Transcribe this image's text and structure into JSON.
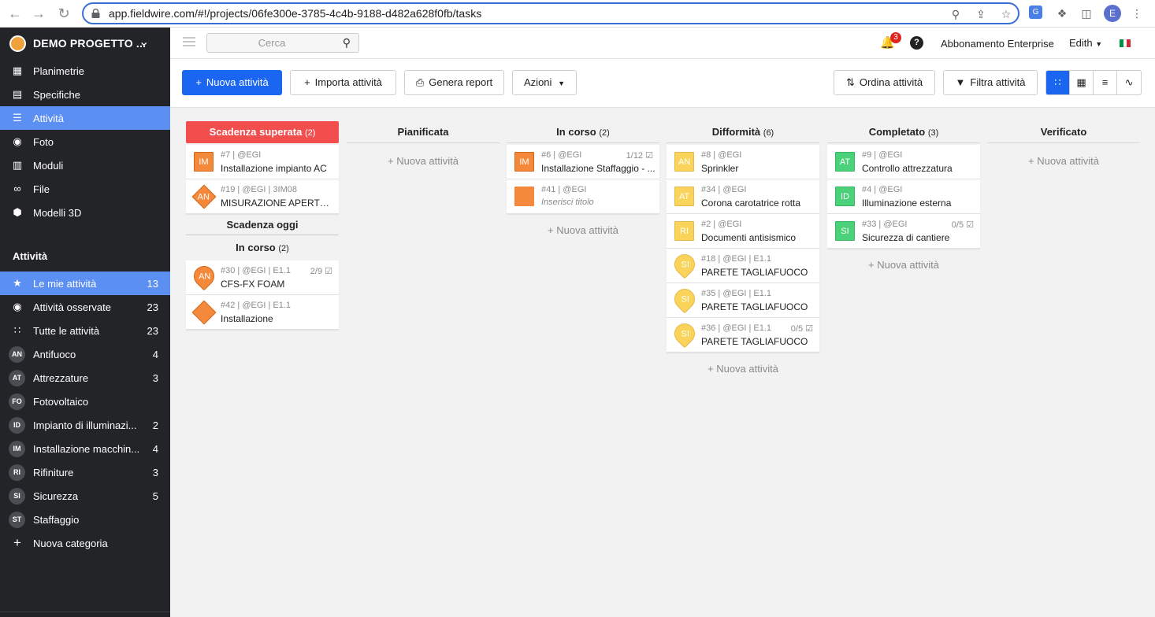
{
  "browser": {
    "url": "app.fieldwire.com/#!/projects/06fe300e-3785-4c4b-9188-d482a628f0fb/tasks",
    "profile_initial": "E"
  },
  "sidebar": {
    "project_name": "DEMO PROGETTO ...",
    "nav_items": [
      {
        "label": "Planimetrie",
        "icon": "floorplan-icon"
      },
      {
        "label": "Specifiche",
        "icon": "specs-icon"
      },
      {
        "label": "Attività",
        "icon": "list-icon",
        "active": true
      },
      {
        "label": "Foto",
        "icon": "camera-icon"
      },
      {
        "label": "Moduli",
        "icon": "clipboard-icon"
      },
      {
        "label": "File",
        "icon": "paperclip-icon"
      },
      {
        "label": "Modelli 3D",
        "icon": "cube-icon"
      }
    ],
    "section_title": "Attività",
    "filters": [
      {
        "label": "Le mie attività",
        "count": "13",
        "icon": "star-icon",
        "active": true
      },
      {
        "label": "Attività osservate",
        "count": "23",
        "icon": "eye-icon"
      },
      {
        "label": "Tutte le attività",
        "count": "23",
        "icon": "grid-icon"
      }
    ],
    "categories": [
      {
        "code": "AN",
        "label": "Antifuoco",
        "count": "4"
      },
      {
        "code": "AT",
        "label": "Attrezzature",
        "count": "3"
      },
      {
        "code": "FO",
        "label": "Fotovoltaico",
        "count": ""
      },
      {
        "code": "ID",
        "label": "Impianto di illuminazi...",
        "count": "2"
      },
      {
        "code": "IM",
        "label": "Installazione macchin...",
        "count": "4"
      },
      {
        "code": "RI",
        "label": "Rifiniture",
        "count": "3"
      },
      {
        "code": "SI",
        "label": "Sicurezza",
        "count": "5"
      },
      {
        "code": "ST",
        "label": "Staffaggio",
        "count": ""
      }
    ],
    "new_category": "Nuova categoria"
  },
  "header": {
    "search_placeholder": "Cerca",
    "notifications_count": "3",
    "subscription": "Abbonamento Enterprise",
    "user": "Edith",
    "flag_colors": [
      "#009246",
      "#ffffff",
      "#ce2b37"
    ]
  },
  "toolbar": {
    "new_task": "Nuova attività",
    "import_tasks": "Importa attività",
    "generate_report": "Genera report",
    "actions": "Azioni",
    "sort_tasks": "Ordina attività",
    "filter_tasks": "Filtra attività"
  },
  "colors": {
    "accent": "#1a66f0",
    "overdue": "#f24e4e",
    "orange": "#f5893b",
    "yellow": "#fad35a",
    "green": "#4bd179"
  },
  "board": {
    "add_label": "+ Nuova attività",
    "columns": [
      {
        "title": "Scadenza superata",
        "count": "(2)",
        "cards": [
          {
            "meta": "#7 | @EGI",
            "title": "Installazione impianto AC",
            "tag": "IM",
            "color": "#f5893b",
            "shape": "square"
          },
          {
            "meta": "#19 | @EGI | 3IM08",
            "title": "MISURAZIONE APERTURE",
            "tag": "AN",
            "color": "#f5893b",
            "shape": "diamond"
          }
        ],
        "subsection": "Scadenza oggi",
        "subgroup": {
          "title": "In corso",
          "count": "(2)"
        },
        "sub_cards": [
          {
            "meta": "#30 | @EGI | E1.1",
            "title": "CFS-FX FOAM",
            "tag": "AN",
            "color": "#f5893b",
            "shape": "pin",
            "check": "2/9"
          },
          {
            "meta": "#42 | @EGI | E1.1",
            "title": "Installazione",
            "tag": "",
            "color": "#f5893b",
            "shape": "diamond"
          }
        ]
      },
      {
        "title": "Pianificata",
        "count": "",
        "cards": []
      },
      {
        "title": "In corso",
        "count": "(2)",
        "cards": [
          {
            "meta": "#6 | @EGI",
            "title": "Installazione Staffaggio - ...",
            "tag": "IM",
            "color": "#f5893b",
            "shape": "square",
            "check": "1/12"
          },
          {
            "meta": "#41 | @EGI",
            "title": "Inserisci titolo",
            "tag": "",
            "color": "#f5893b",
            "shape": "square",
            "placeholder": true
          }
        ]
      },
      {
        "title": "Difformità",
        "count": "(6)",
        "cards": [
          {
            "meta": "#8 | @EGI",
            "title": "Sprinkler",
            "tag": "AN",
            "color": "#fad35a",
            "shape": "square"
          },
          {
            "meta": "#34 | @EGI",
            "title": "Corona carotatrice rotta",
            "tag": "AT",
            "color": "#fad35a",
            "shape": "square"
          },
          {
            "meta": "#2 | @EGI",
            "title": "Documenti antisismico",
            "tag": "RI",
            "color": "#fad35a",
            "shape": "square"
          },
          {
            "meta": "#18 | @EGI | E1.1",
            "title": "PARETE TAGLIAFUOCO",
            "tag": "SI",
            "color": "#fad35a",
            "shape": "pin"
          },
          {
            "meta": "#35 | @EGI | E1.1",
            "title": "PARETE TAGLIAFUOCO",
            "tag": "SI",
            "color": "#fad35a",
            "shape": "pin"
          },
          {
            "meta": "#36 | @EGI | E1.1",
            "title": "PARETE TAGLIAFUOCO",
            "tag": "SI",
            "color": "#fad35a",
            "shape": "pin",
            "check": "0/5"
          }
        ]
      },
      {
        "title": "Completato",
        "count": "(3)",
        "cards": [
          {
            "meta": "#9 | @EGI",
            "title": "Controllo attrezzatura",
            "tag": "AT",
            "color": "#4bd179",
            "shape": "square"
          },
          {
            "meta": "#4 | @EGI",
            "title": "Illuminazione esterna",
            "tag": "ID",
            "color": "#4bd179",
            "shape": "square"
          },
          {
            "meta": "#33 | @EGI",
            "title": "Sicurezza di cantiere",
            "tag": "SI",
            "color": "#4bd179",
            "shape": "square",
            "check": "0/5"
          }
        ]
      },
      {
        "title": "Verificato",
        "count": "",
        "cards": []
      }
    ]
  }
}
